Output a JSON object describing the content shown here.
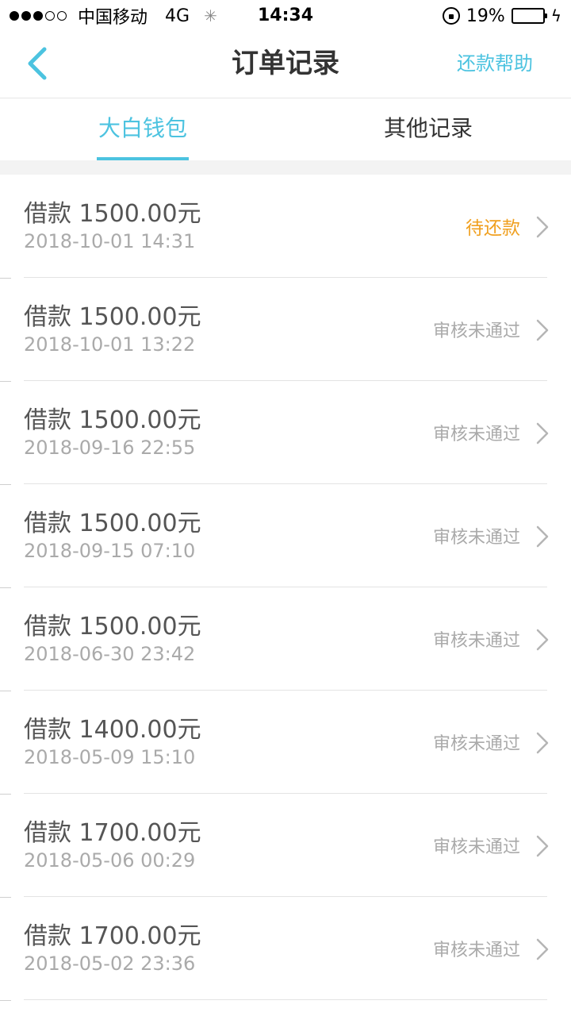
{
  "status_bar": {
    "carrier": "中国移动",
    "network": "4G",
    "time": "14:34",
    "battery": "19%",
    "battery_level": 0.19,
    "signal_bars": 3
  },
  "nav": {
    "title": "订单记录",
    "help": "还款帮助"
  },
  "tabs": [
    {
      "label": "大白钱包",
      "active": true
    },
    {
      "label": "其他记录",
      "active": false
    }
  ],
  "orders": [
    {
      "title": "借款 1500.00元",
      "date": "2018-10-01 14:31",
      "status": "待还款",
      "pending": true
    },
    {
      "title": "借款 1500.00元",
      "date": "2018-10-01 13:22",
      "status": "审核未通过",
      "pending": false
    },
    {
      "title": "借款 1500.00元",
      "date": "2018-09-16 22:55",
      "status": "审核未通过",
      "pending": false
    },
    {
      "title": "借款 1500.00元",
      "date": "2018-09-15 07:10",
      "status": "审核未通过",
      "pending": false
    },
    {
      "title": "借款 1500.00元",
      "date": "2018-06-30 23:42",
      "status": "审核未通过",
      "pending": false
    },
    {
      "title": "借款 1400.00元",
      "date": "2018-05-09 15:10",
      "status": "审核未通过",
      "pending": false
    },
    {
      "title": "借款 1700.00元",
      "date": "2018-05-06 00:29",
      "status": "审核未通过",
      "pending": false
    },
    {
      "title": "借款 1700.00元",
      "date": "2018-05-02 23:36",
      "status": "审核未通过",
      "pending": false
    }
  ],
  "colors": {
    "accent": "#4cc3e0",
    "pending": "#f0a020",
    "battery_low": "#e02020"
  }
}
